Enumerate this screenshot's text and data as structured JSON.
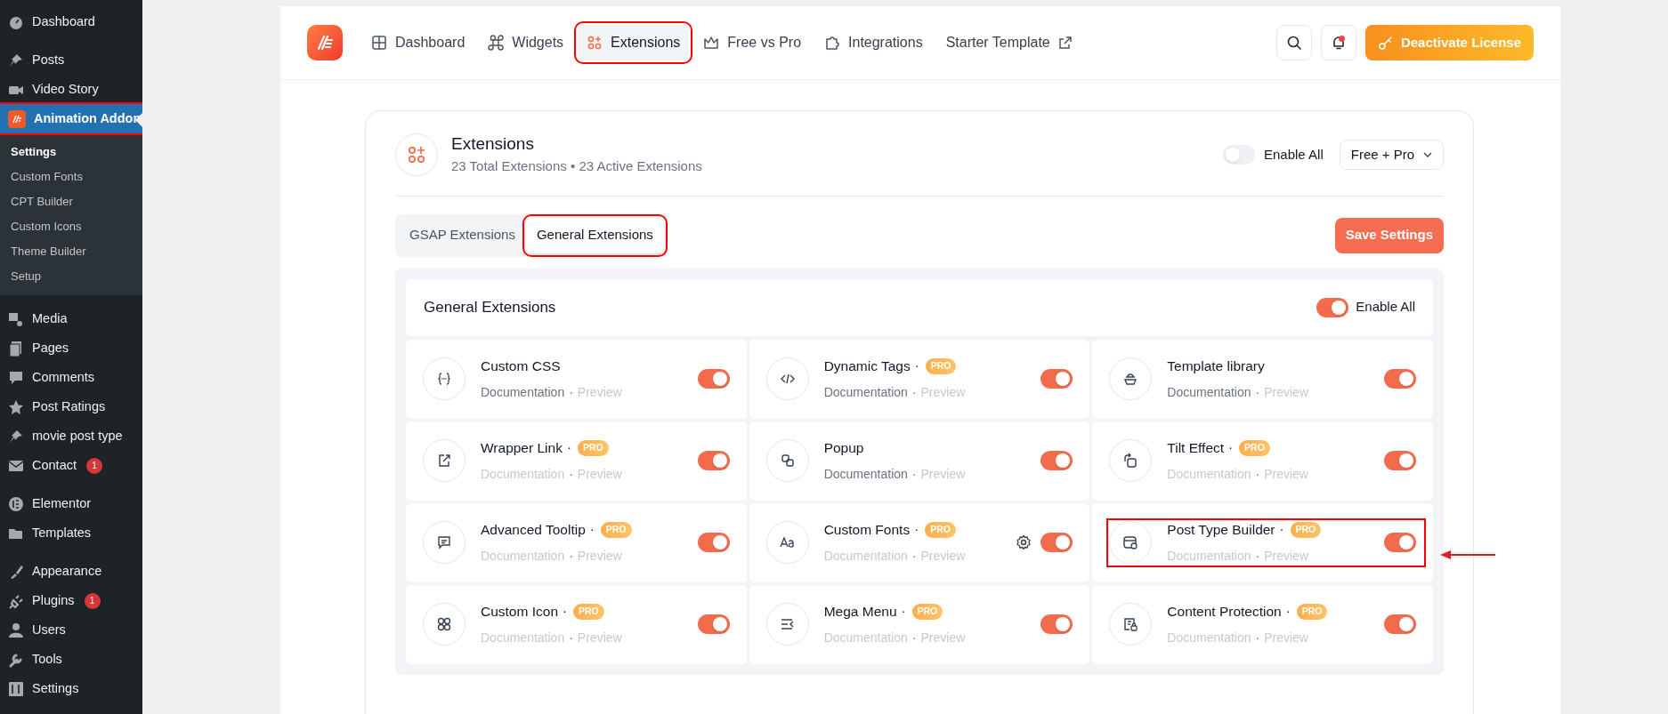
{
  "sidebar": {
    "groups": [
      [
        {
          "label": "Dashboard",
          "current": false,
          "highlighted": false
        }
      ],
      [
        {
          "label": "Posts",
          "current": false,
          "highlighted": false
        },
        {
          "label": "Video Story",
          "current": false,
          "highlighted": false
        },
        {
          "label": "Animation Addon",
          "current": true,
          "highlighted": true,
          "children": [
            {
              "label": "Settings",
              "selected": true
            },
            {
              "label": "Custom Fonts",
              "selected": false
            },
            {
              "label": "CPT Builder",
              "selected": false
            },
            {
              "label": "Custom Icons",
              "selected": false
            },
            {
              "label": "Theme Builder",
              "selected": false
            },
            {
              "label": "Setup",
              "selected": false
            }
          ]
        }
      ],
      [
        {
          "label": "Media",
          "current": false,
          "highlighted": false
        },
        {
          "label": "Pages",
          "current": false,
          "highlighted": false
        },
        {
          "label": "Comments",
          "current": false,
          "highlighted": false
        },
        {
          "label": "Post Ratings",
          "current": false,
          "highlighted": false
        },
        {
          "label": "movie post type",
          "current": false,
          "highlighted": false
        },
        {
          "label": "Contact",
          "current": false,
          "highlighted": false,
          "badge": "1"
        }
      ],
      [
        {
          "label": "Elementor",
          "current": false,
          "highlighted": false
        },
        {
          "label": "Templates",
          "current": false,
          "highlighted": false
        }
      ],
      [
        {
          "label": "Appearance",
          "current": false,
          "highlighted": false
        },
        {
          "label": "Plugins",
          "current": false,
          "highlighted": false,
          "badge": "1"
        },
        {
          "label": "Users",
          "current": false,
          "highlighted": false
        },
        {
          "label": "Tools",
          "current": false,
          "highlighted": false
        },
        {
          "label": "Settings",
          "current": false,
          "highlighted": false
        }
      ]
    ]
  },
  "nav": {
    "tabs": [
      {
        "label": "Dashboard",
        "selected": false,
        "highlighted": false,
        "external": false
      },
      {
        "label": "Widgets",
        "selected": false,
        "highlighted": false,
        "external": false
      },
      {
        "label": "Extensions",
        "selected": true,
        "highlighted": true,
        "external": false
      },
      {
        "label": "Free vs Pro",
        "selected": false,
        "highlighted": false,
        "external": false
      },
      {
        "label": "Integrations",
        "selected": false,
        "highlighted": false,
        "external": false
      },
      {
        "label": "Starter Template",
        "selected": false,
        "highlighted": false,
        "external": true
      }
    ],
    "notification_dot": true,
    "license_button": "Deactivate License"
  },
  "extensions": {
    "title": "Extensions",
    "summary": "23 Total Extensions • 23 Active Extensions",
    "enable_all": {
      "label": "Enable All",
      "on": false
    },
    "filter": "Free + Pro"
  },
  "subtabs": [
    {
      "label": "GSAP Extensions",
      "selected": false,
      "highlighted": false
    },
    {
      "label": "General Extensions",
      "selected": true,
      "highlighted": true
    }
  ],
  "save_button": "Save Settings",
  "section": {
    "title": "General Extensions",
    "pointer_arrow": true,
    "enable_all": {
      "label": "Enable All",
      "on": true
    },
    "items": [
      {
        "name": "Custom CSS",
        "on": true,
        "documentation": "Documentation",
        "dot": "·",
        "preview": "Preview",
        "docs_active": true,
        "settings": false,
        "highlighted": false
      },
      {
        "name": "Dynamic Tags",
        "separator": "·",
        "badge": "PRO",
        "on": true,
        "documentation": "Documentation",
        "dot": "·",
        "preview": "Preview",
        "docs_active": true,
        "settings": false,
        "highlighted": false
      },
      {
        "name": "Template library",
        "on": true,
        "documentation": "Documentation",
        "dot": "·",
        "preview": "Preview",
        "docs_active": true,
        "settings": false,
        "highlighted": false
      },
      {
        "name": "Wrapper Link",
        "separator": "·",
        "badge": "PRO",
        "on": true,
        "documentation": "Documentation",
        "dot": "·",
        "preview": "Preview",
        "docs_active": false,
        "settings": false,
        "highlighted": false
      },
      {
        "name": "Popup",
        "on": true,
        "documentation": "Documentation",
        "dot": "·",
        "preview": "Preview",
        "docs_active": true,
        "settings": false,
        "highlighted": false
      },
      {
        "name": "Tilt Effect",
        "separator": "·",
        "badge": "PRO",
        "on": true,
        "documentation": "Documentation",
        "dot": "·",
        "preview": "Preview",
        "docs_active": false,
        "settings": false,
        "highlighted": false
      },
      {
        "name": "Advanced Tooltip",
        "separator": "·",
        "badge": "PRO",
        "on": true,
        "documentation": "Documentation",
        "dot": "·",
        "preview": "Preview",
        "docs_active": false,
        "settings": false,
        "highlighted": false
      },
      {
        "name": "Custom Fonts",
        "separator": "·",
        "badge": "PRO",
        "on": true,
        "documentation": "Documentation",
        "dot": "·",
        "preview": "Preview",
        "docs_active": false,
        "settings": true,
        "highlighted": false
      },
      {
        "name": "Post Type Builder",
        "separator": "·",
        "badge": "PRO",
        "on": true,
        "documentation": "Documentation",
        "dot": "·",
        "preview": "Preview",
        "docs_active": false,
        "settings": false,
        "highlighted": true
      },
      {
        "name": "Custom Icon",
        "separator": "·",
        "badge": "PRO",
        "on": true,
        "documentation": "Documentation",
        "dot": "·",
        "preview": "Preview",
        "docs_active": false,
        "settings": false,
        "highlighted": false
      },
      {
        "name": "Mega Menu",
        "separator": "·",
        "badge": "PRO",
        "on": true,
        "documentation": "Documentation",
        "dot": "·",
        "preview": "Preview",
        "docs_active": false,
        "settings": false,
        "highlighted": false
      },
      {
        "name": "Content Protection",
        "separator": "·",
        "badge": "PRO",
        "on": true,
        "documentation": "Documentation",
        "dot": "·",
        "preview": "Preview",
        "docs_active": false,
        "settings": false,
        "highlighted": false
      }
    ]
  }
}
